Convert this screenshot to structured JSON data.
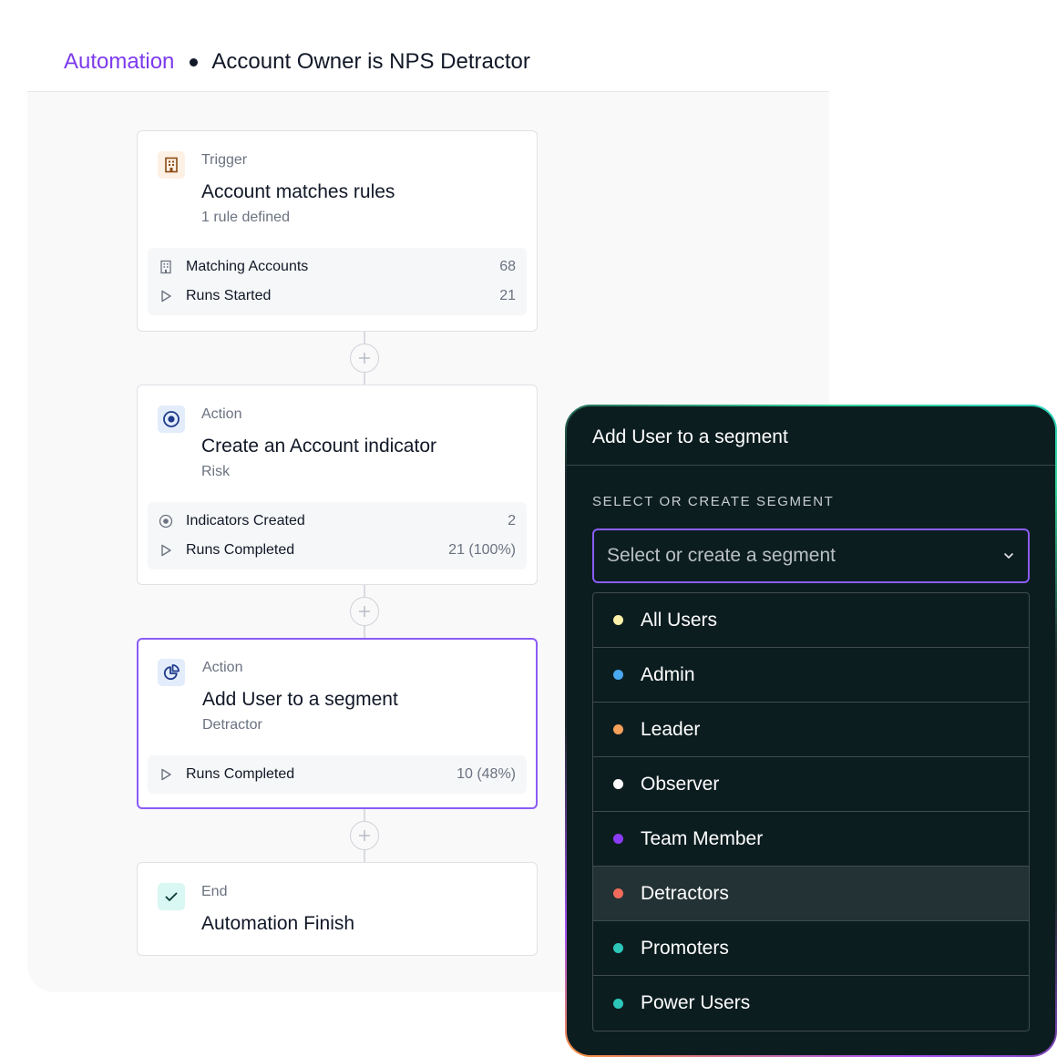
{
  "header": {
    "breadcrumb_link": "Automation",
    "title": "Account Owner is NPS Detractor"
  },
  "steps": [
    {
      "label": "Trigger",
      "title": "Account matches rules",
      "subtitle": "1 rule defined",
      "icon": "building-icon",
      "stats": [
        {
          "label": "Matching Accounts",
          "value": "68",
          "icon": "building-icon"
        },
        {
          "label": "Runs Started",
          "value": "21",
          "icon": "play-icon"
        }
      ]
    },
    {
      "label": "Action",
      "title": "Create an Account indicator",
      "subtitle": "Risk",
      "icon": "target-icon",
      "stats": [
        {
          "label": "Indicators Created",
          "value": "2",
          "icon": "target-icon"
        },
        {
          "label": "Runs Completed",
          "value": "21 (100%)",
          "icon": "play-icon"
        }
      ]
    },
    {
      "label": "Action",
      "title": "Add User to a segment",
      "subtitle": "Detractor",
      "icon": "pie-chart-icon",
      "stats": [
        {
          "label": "Runs Completed",
          "value": "10 (48%)",
          "icon": "play-icon"
        }
      ]
    },
    {
      "label": "End",
      "title": "Automation Finish",
      "icon": "check-icon"
    }
  ],
  "panel": {
    "title": "Add User to a segment",
    "section_label": "SELECT OR CREATE SEGMENT",
    "select_placeholder": "Select or create a segment",
    "options": [
      {
        "label": "All Users",
        "color": "#fdf0a8"
      },
      {
        "label": "Admin",
        "color": "#4aa8f0"
      },
      {
        "label": "Leader",
        "color": "#f6a05a"
      },
      {
        "label": "Observer",
        "color": "#ffffff"
      },
      {
        "label": "Team Member",
        "color": "#8b3cf6"
      },
      {
        "label": "Detractors",
        "color": "#f26b5b"
      },
      {
        "label": "Promoters",
        "color": "#2dc7b9"
      },
      {
        "label": "Power Users",
        "color": "#2dc7b9"
      }
    ],
    "highlighted_option": "Detractors"
  },
  "colors": {
    "accent": "#7c3aed",
    "panel_bg": "#0c1d20"
  }
}
